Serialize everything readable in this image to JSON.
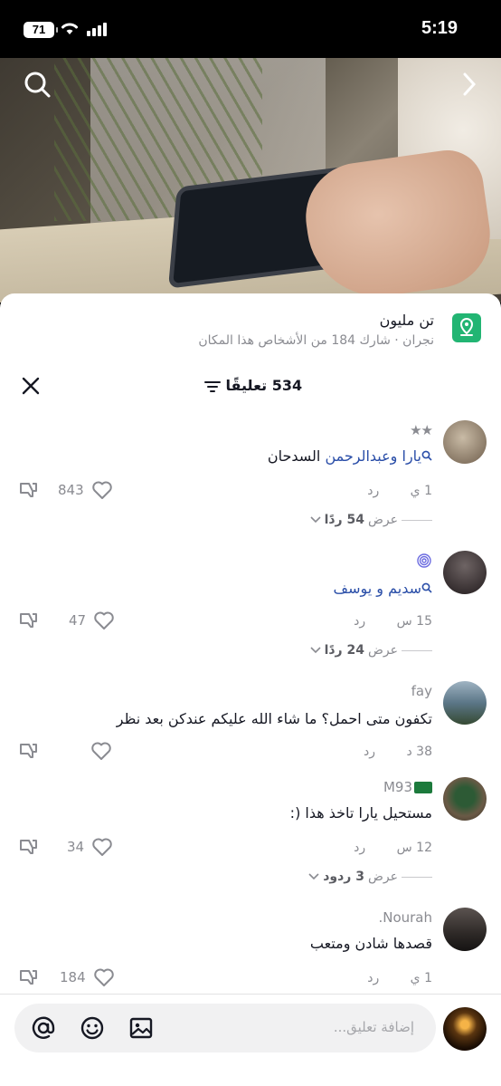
{
  "status_bar": {
    "time": "5:19",
    "battery": "71"
  },
  "location": {
    "title": "تن مليون",
    "subtitle": "نجران · شارك 184 من الأشخاص هذا المكان"
  },
  "comments_header": {
    "count_label": "534 تعليقًا"
  },
  "comments": [
    {
      "username": "★★",
      "mention": "يارا وعبدالرحمن",
      "text": " السدحان",
      "time": "1 ي",
      "reply_label": "رد",
      "likes": "843",
      "view_replies": "عرض",
      "view_replies_count": "54 ردًا",
      "avatar_color": "#8a7a66"
    },
    {
      "username": "",
      "mention": "سديم و يوسف",
      "text": "",
      "time": "15 س",
      "reply_label": "رد",
      "likes": "47",
      "view_replies": "عرض",
      "view_replies_count": "24 ردًا",
      "avatar_color": "#3b3136"
    },
    {
      "username": "fay",
      "mention": "",
      "text": "تكفون متى احمل؟ ما شاء الله عليكم عندكن بعد نظر",
      "time": "38 د",
      "reply_label": "رد",
      "likes": "",
      "view_replies": "",
      "view_replies_count": "",
      "avatar_color": "#6f8595"
    },
    {
      "username": "M93",
      "mention": "",
      "text": "مستحيل يارا تاخذ هذا (:",
      "time": "12 س",
      "reply_label": "رد",
      "likes": "34",
      "view_replies": "عرض",
      "view_replies_count": "3 ردود",
      "avatar_color": "#4d5a3d"
    },
    {
      "username": "Nourah.",
      "mention": "",
      "text": "قصدها شادن ومتعب",
      "time": "1 ي",
      "reply_label": "رد",
      "likes": "184",
      "view_replies": "",
      "view_replies_count": "",
      "avatar_color": "#3a3533"
    }
  ],
  "input": {
    "placeholder": "إضافة تعليق..."
  },
  "colors": {
    "accent_link": "#2a4ea8",
    "location_icon": "#22b573"
  }
}
